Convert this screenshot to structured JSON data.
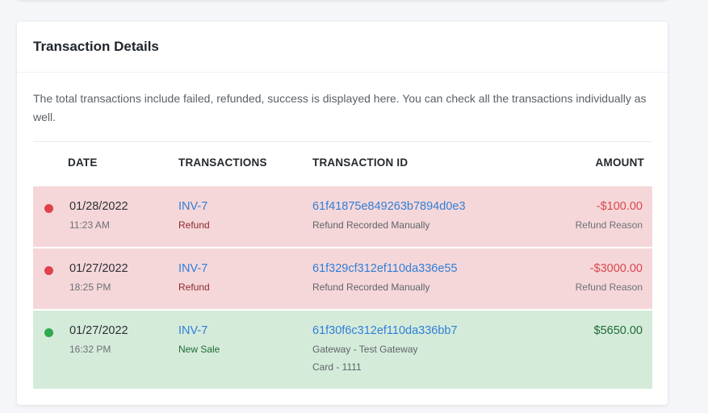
{
  "colors": {
    "refund_bg": "#f6d7d9",
    "sale_bg": "#d5ebda",
    "refund_dot": "#e0424d",
    "sale_dot": "#2fa84f",
    "link": "#2f7fd8",
    "negative_amount": "#d94650",
    "positive_amount": "#1f6b35",
    "refund_label": "#8a2a2a",
    "sale_label": "#1f6b35"
  },
  "card": {
    "title": "Transaction Details",
    "description": "The total transactions include failed, refunded, success is displayed here. You can check all the transactions individually as well."
  },
  "table": {
    "headers": {
      "date": "DATE",
      "transactions": "TRANSACTIONS",
      "transaction_id": "TRANSACTION ID",
      "amount": "AMOUNT"
    },
    "rows": [
      {
        "status": "refund",
        "date": "01/28/2022",
        "time": "11:23 AM",
        "invoice": "INV-7",
        "type": "Refund",
        "transaction_id": "61f41875e849263b7894d0e3",
        "detail": "Refund Recorded Manually",
        "detail2": "",
        "amount": "-$100.00",
        "amount_note": "Refund Reason"
      },
      {
        "status": "refund",
        "date": "01/27/2022",
        "time": "18:25 PM",
        "invoice": "INV-7",
        "type": "Refund",
        "transaction_id": "61f329cf312ef110da336e55",
        "detail": "Refund Recorded Manually",
        "detail2": "",
        "amount": "-$3000.00",
        "amount_note": "Refund Reason"
      },
      {
        "status": "sale",
        "date": "01/27/2022",
        "time": "16:32 PM",
        "invoice": "INV-7",
        "type": "New Sale",
        "transaction_id": "61f30f6c312ef110da336bb7",
        "detail": "Gateway - Test Gateway",
        "detail2": "Card - 1111",
        "amount": "$5650.00",
        "amount_note": ""
      }
    ]
  }
}
